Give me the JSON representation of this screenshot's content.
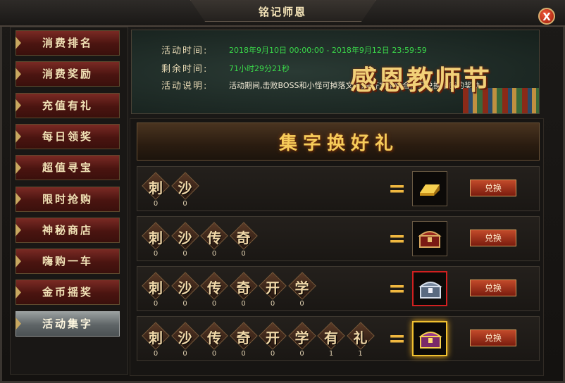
{
  "window": {
    "title": "铭记师恩"
  },
  "sidebar": {
    "items": [
      {
        "label": "消费排名",
        "active": false
      },
      {
        "label": "消费奖励",
        "active": false
      },
      {
        "label": "充值有礼",
        "active": false
      },
      {
        "label": "每日领奖",
        "active": false
      },
      {
        "label": "超值寻宝",
        "active": false
      },
      {
        "label": "限时抢购",
        "active": false
      },
      {
        "label": "神秘商店",
        "active": false
      },
      {
        "label": "嗨购一车",
        "active": false
      },
      {
        "label": "金币摇奖",
        "active": false
      },
      {
        "label": "活动集字",
        "active": true
      }
    ]
  },
  "banner": {
    "time_label": "活动时间:",
    "time_value": "2018年9月10日 00:00:00 - 2018年9月12日 23:59:59",
    "remain_label": "剩余时间:",
    "remain_value": "71小时29分21秒",
    "desc_label": "活动说明:",
    "desc_value": "活动期间,击败BOSS和小怪可掉落文字,集齐文字组合即可兑换相应的奖励。",
    "deco_title": "感恩教师节",
    "value_color": "#3ad84a"
  },
  "section": {
    "title": "集字换好礼"
  },
  "rows": [
    {
      "chars": [
        "刺",
        "沙"
      ],
      "counts": [
        "0",
        "0"
      ],
      "reward": "gold-bar-icon",
      "button": "兑换"
    },
    {
      "chars": [
        "刺",
        "沙",
        "传",
        "奇"
      ],
      "counts": [
        "0",
        "0",
        "0",
        "0"
      ],
      "reward": "red-chest-icon",
      "button": "兑换"
    },
    {
      "chars": [
        "刺",
        "沙",
        "传",
        "奇",
        "开",
        "学"
      ],
      "counts": [
        "0",
        "0",
        "0",
        "0",
        "0",
        "0"
      ],
      "reward": "silver-chest-icon",
      "button": "兑换"
    },
    {
      "chars": [
        "刺",
        "沙",
        "传",
        "奇",
        "开",
        "学",
        "有",
        "礼"
      ],
      "counts": [
        "0",
        "0",
        "0",
        "0",
        "0",
        "0",
        "1",
        "1"
      ],
      "reward": "gold-chest-icon",
      "button": "兑换"
    }
  ],
  "close_glyph": "X"
}
